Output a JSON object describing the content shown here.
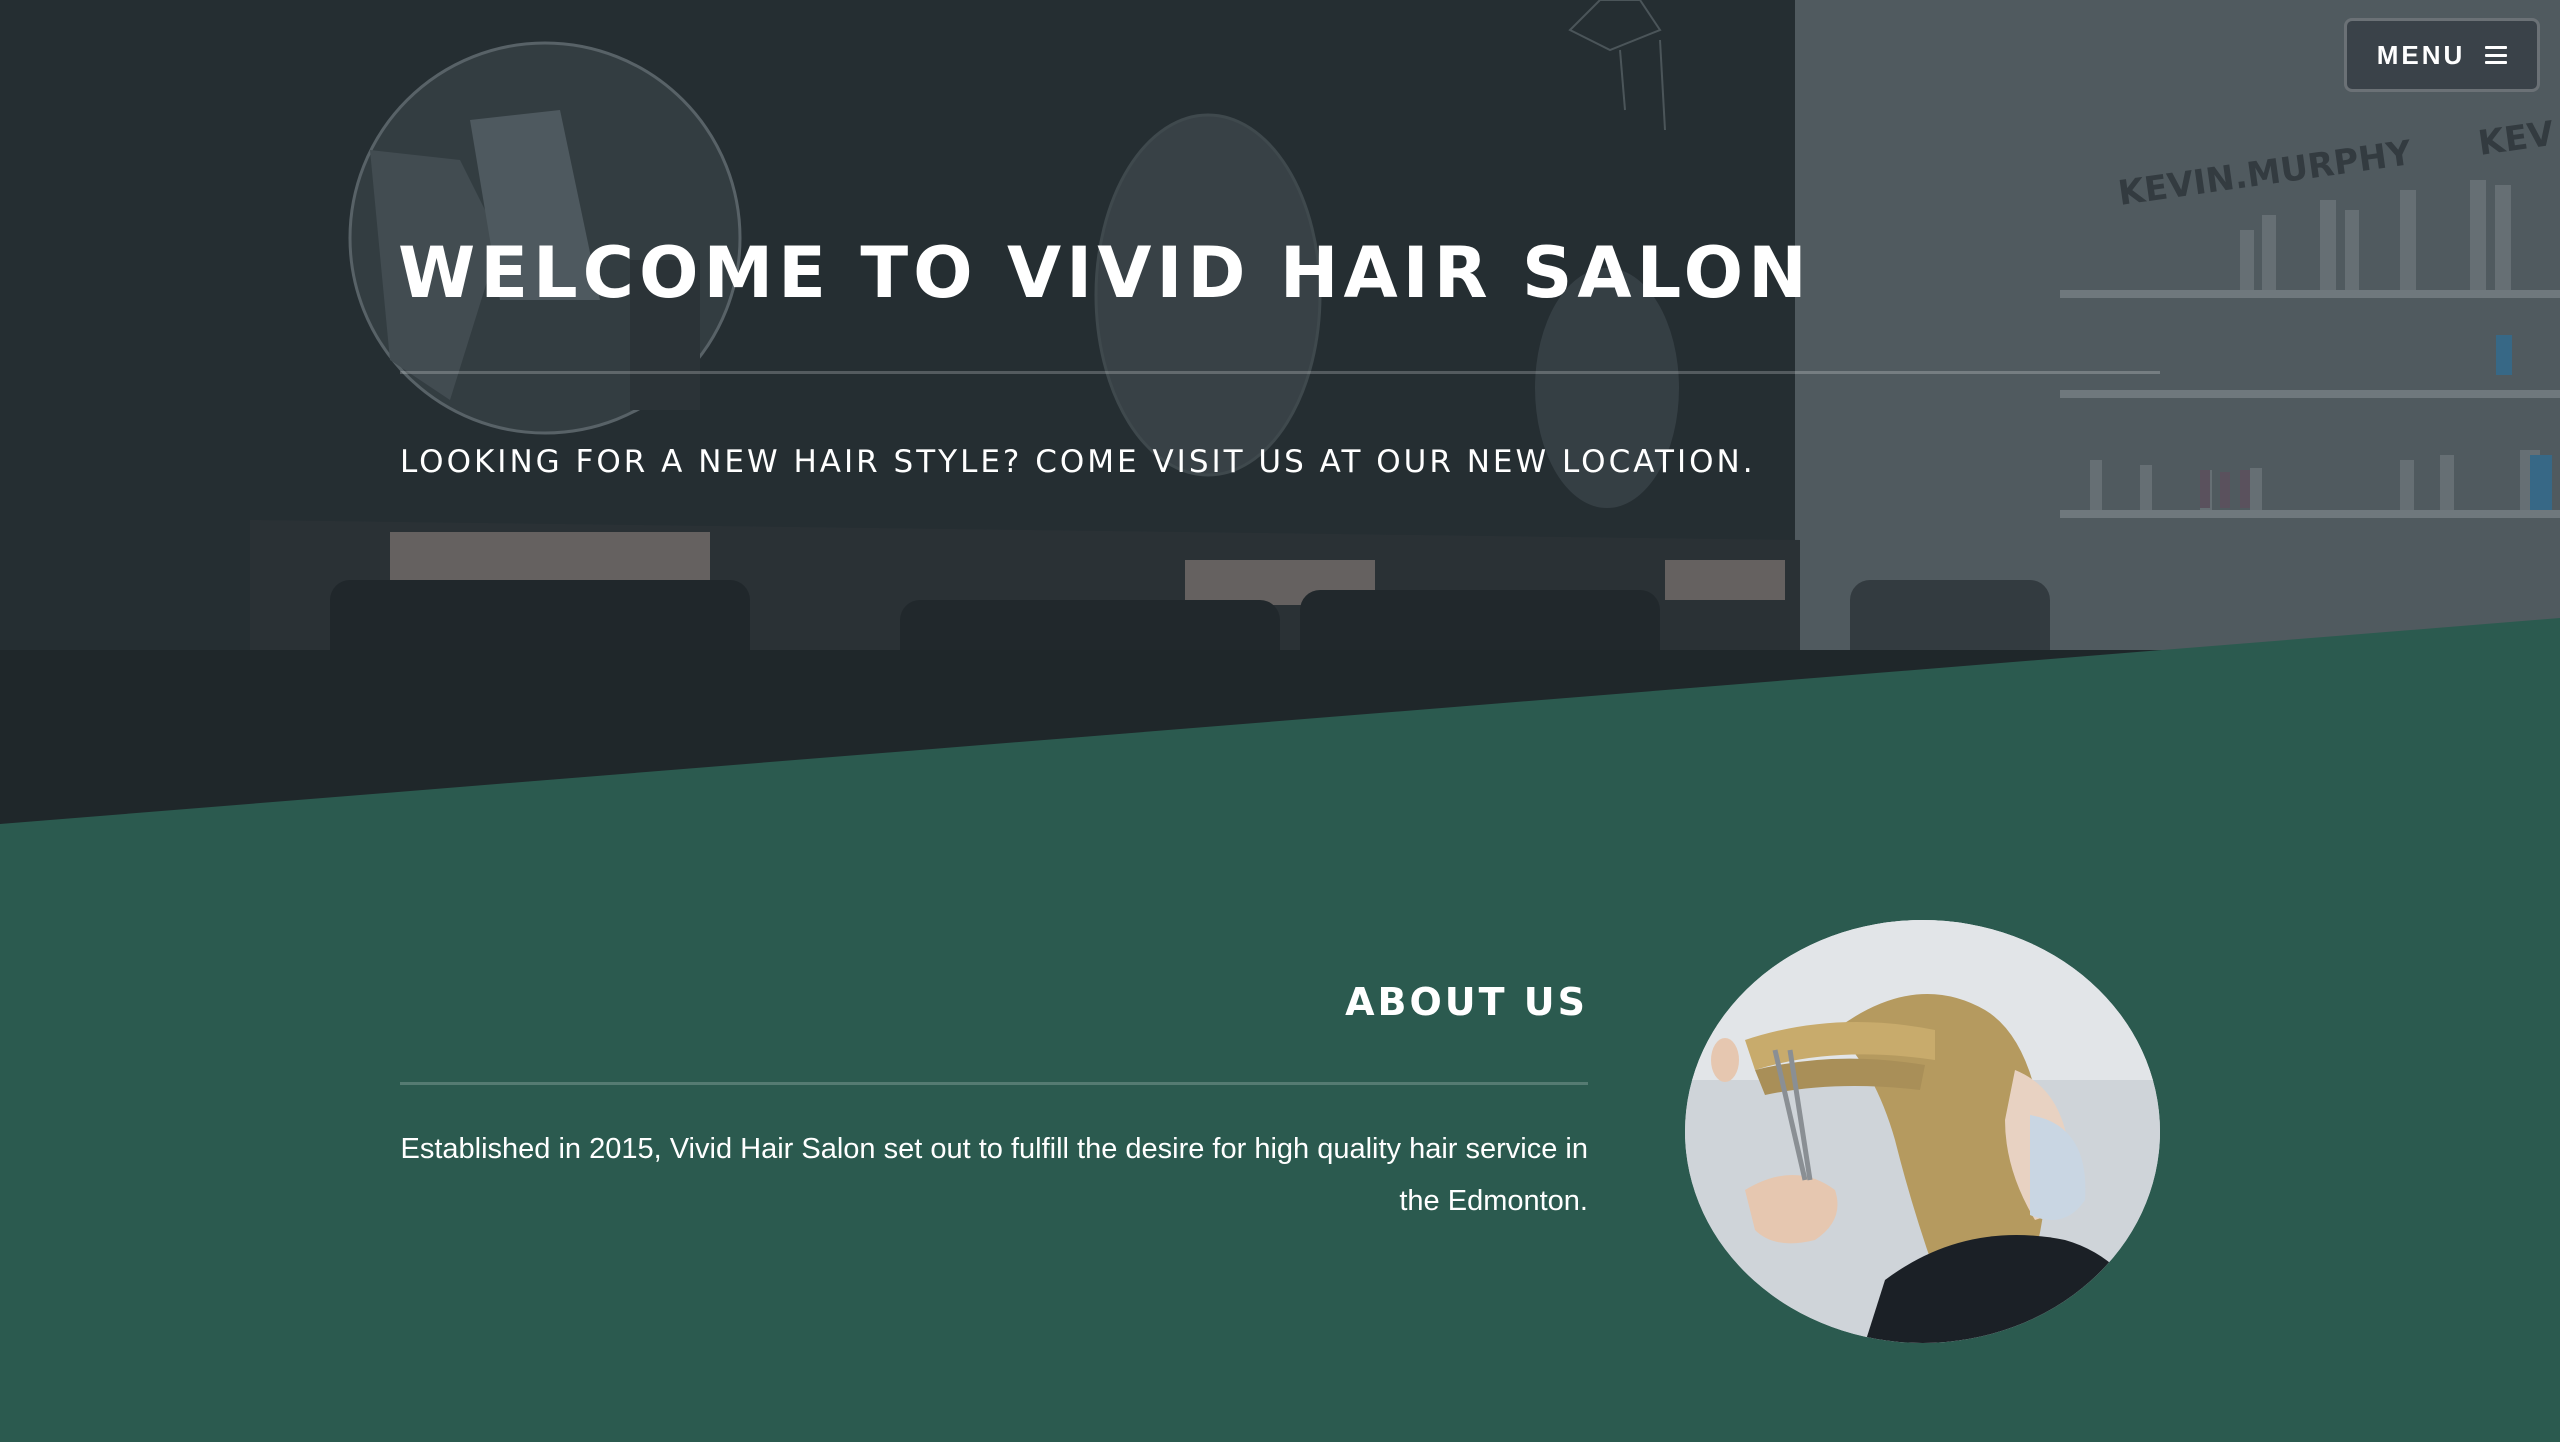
{
  "nav": {
    "menu_label": "MENU",
    "menu_icon": "hamburger-icon"
  },
  "hero": {
    "title": "WELCOME TO VIVID HAIR SALON",
    "subtitle": "LOOKING FOR A NEW HAIR STYLE? COME VISIT US AT OUR NEW LOCATION.",
    "photo_sign_text": "KEVIN.MURPHY",
    "photo_sign_text_2": "KEV"
  },
  "about": {
    "heading": "ABOUT US",
    "body": "Established in 2015, Vivid Hair Salon set out to fulfill the desire for high quality hair service in the Edmonton."
  },
  "colors": {
    "section_green": "#2b5a4f",
    "hero_dark": "#2a3338",
    "text": "#ffffff"
  }
}
